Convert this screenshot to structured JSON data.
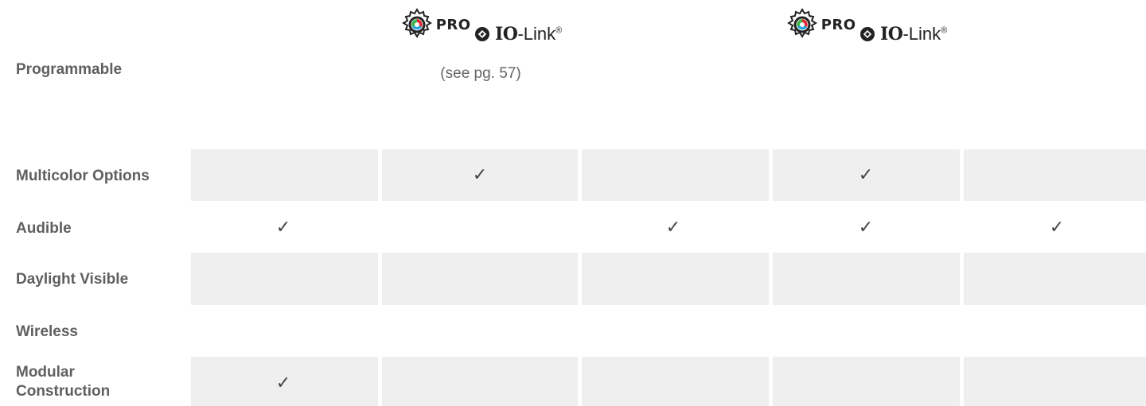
{
  "rows": {
    "programmable": "Programmable",
    "multicolor": "Multicolor Options",
    "audible": "Audible",
    "daylight": "Daylight Visible",
    "wireless": "Wireless",
    "modular": "Modular Construction"
  },
  "programmable_cols": [
    {
      "pro_label": "PRO",
      "io_bold": "IO",
      "io_rest": "-Link",
      "reg": "®",
      "note": "(see pg. 57)"
    },
    {
      "pro_label": "PRO",
      "io_bold": "IO",
      "io_rest": "-Link",
      "reg": "®"
    }
  ],
  "check_glyph": "✓",
  "icons": [
    "gear-color-wheel-icon",
    "io-link-logo-icon",
    "checkmark-icon"
  ],
  "colors": {
    "cell_bg": "#efefef",
    "label": "#5f5f5f",
    "check": "#444444"
  }
}
